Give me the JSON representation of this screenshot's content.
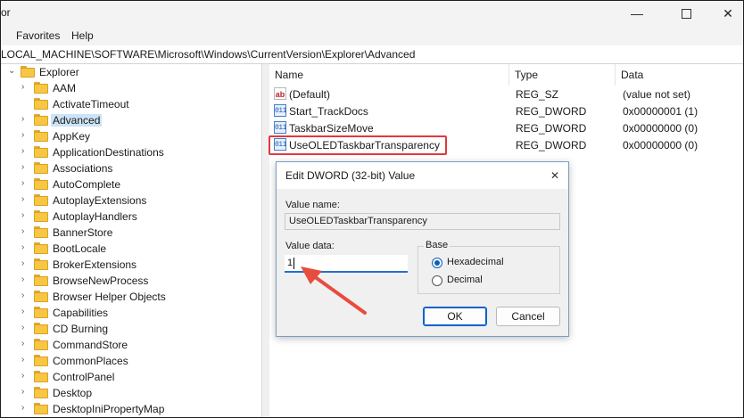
{
  "window": {
    "title_fragment": "or",
    "buttons": [
      "minimize",
      "maximize",
      "close"
    ]
  },
  "menubar": {
    "items": [
      "Favorites",
      "Help"
    ]
  },
  "address": {
    "path": "LOCAL_MACHINE\\SOFTWARE\\Microsoft\\Windows\\CurrentVersion\\Explorer\\Advanced"
  },
  "tree": {
    "parent": "Explorer",
    "items": [
      "AAM",
      "ActivateTimeout",
      "Advanced",
      "AppKey",
      "ApplicationDestinations",
      "Associations",
      "AutoComplete",
      "AutoplayExtensions",
      "AutoplayHandlers",
      "BannerStore",
      "BootLocale",
      "BrokerExtensions",
      "BrowseNewProcess",
      "Browser Helper Objects",
      "Capabilities",
      "CD Burning",
      "CommandStore",
      "CommonPlaces",
      "ControlPanel",
      "Desktop",
      "DesktopIniPropertyMap"
    ],
    "selected": "Advanced"
  },
  "values": {
    "columns": {
      "name": "Name",
      "type": "Type",
      "data": "Data"
    },
    "rows": [
      {
        "name": "(Default)",
        "type": "REG_SZ",
        "data": "(value not set)",
        "icon": "string-value-icon"
      },
      {
        "name": "Start_TrackDocs",
        "type": "REG_DWORD",
        "data": "0x00000001 (1)",
        "icon": "binary-value-icon"
      },
      {
        "name": "TaskbarSizeMove",
        "type": "REG_DWORD",
        "data": "0x00000000 (0)",
        "icon": "binary-value-icon"
      },
      {
        "name": "UseOLEDTaskbarTransparency",
        "type": "REG_DWORD",
        "data": "0x00000000 (0)",
        "icon": "binary-value-icon"
      }
    ]
  },
  "dialog": {
    "title": "Edit DWORD (32-bit) Value",
    "value_name_label": "Value name:",
    "value_name": "UseOLEDTaskbarTransparency",
    "value_data_label": "Value data:",
    "value_data": "1",
    "base_label": "Base",
    "hex_label": "Hexadecimal",
    "dec_label": "Decimal",
    "selected_base": "Hexadecimal",
    "ok_label": "OK",
    "cancel_label": "Cancel"
  },
  "colors": {
    "highlight_box": "#e0393e",
    "annotation_arrow": "#e84c3d",
    "selection": "#cce4f7"
  }
}
